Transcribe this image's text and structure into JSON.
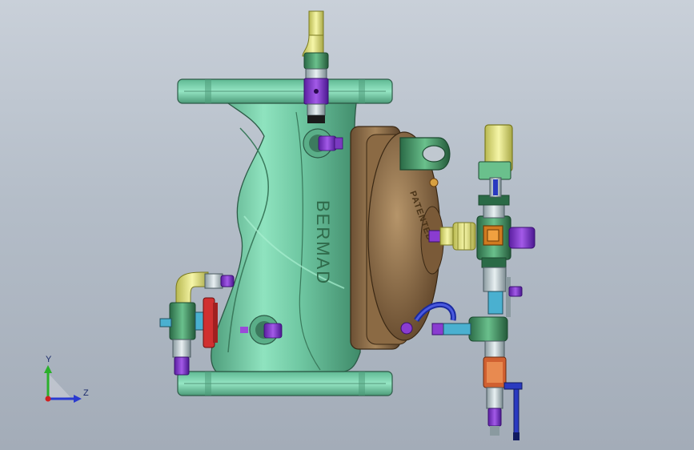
{
  "model": {
    "body_engraving": "BERMAD",
    "cover_engraving": "PATENTED"
  },
  "triad": {
    "y_label": "Y",
    "z_label": "Z"
  },
  "colors": {
    "background_top": "#c9d0d9",
    "background_bottom": "#a3acb8",
    "valve_body": "#7fd6b0",
    "valve_cover": "#8b6a44",
    "fitting_purple": "#8a3cd0",
    "fitting_yellow": "#e8e88a",
    "fitting_orange": "#d06030",
    "tube_blue": "#2a3ac0",
    "axis_y": "#2ab02a",
    "axis_z": "#2a3ad0",
    "axis_origin": "#d02020"
  }
}
